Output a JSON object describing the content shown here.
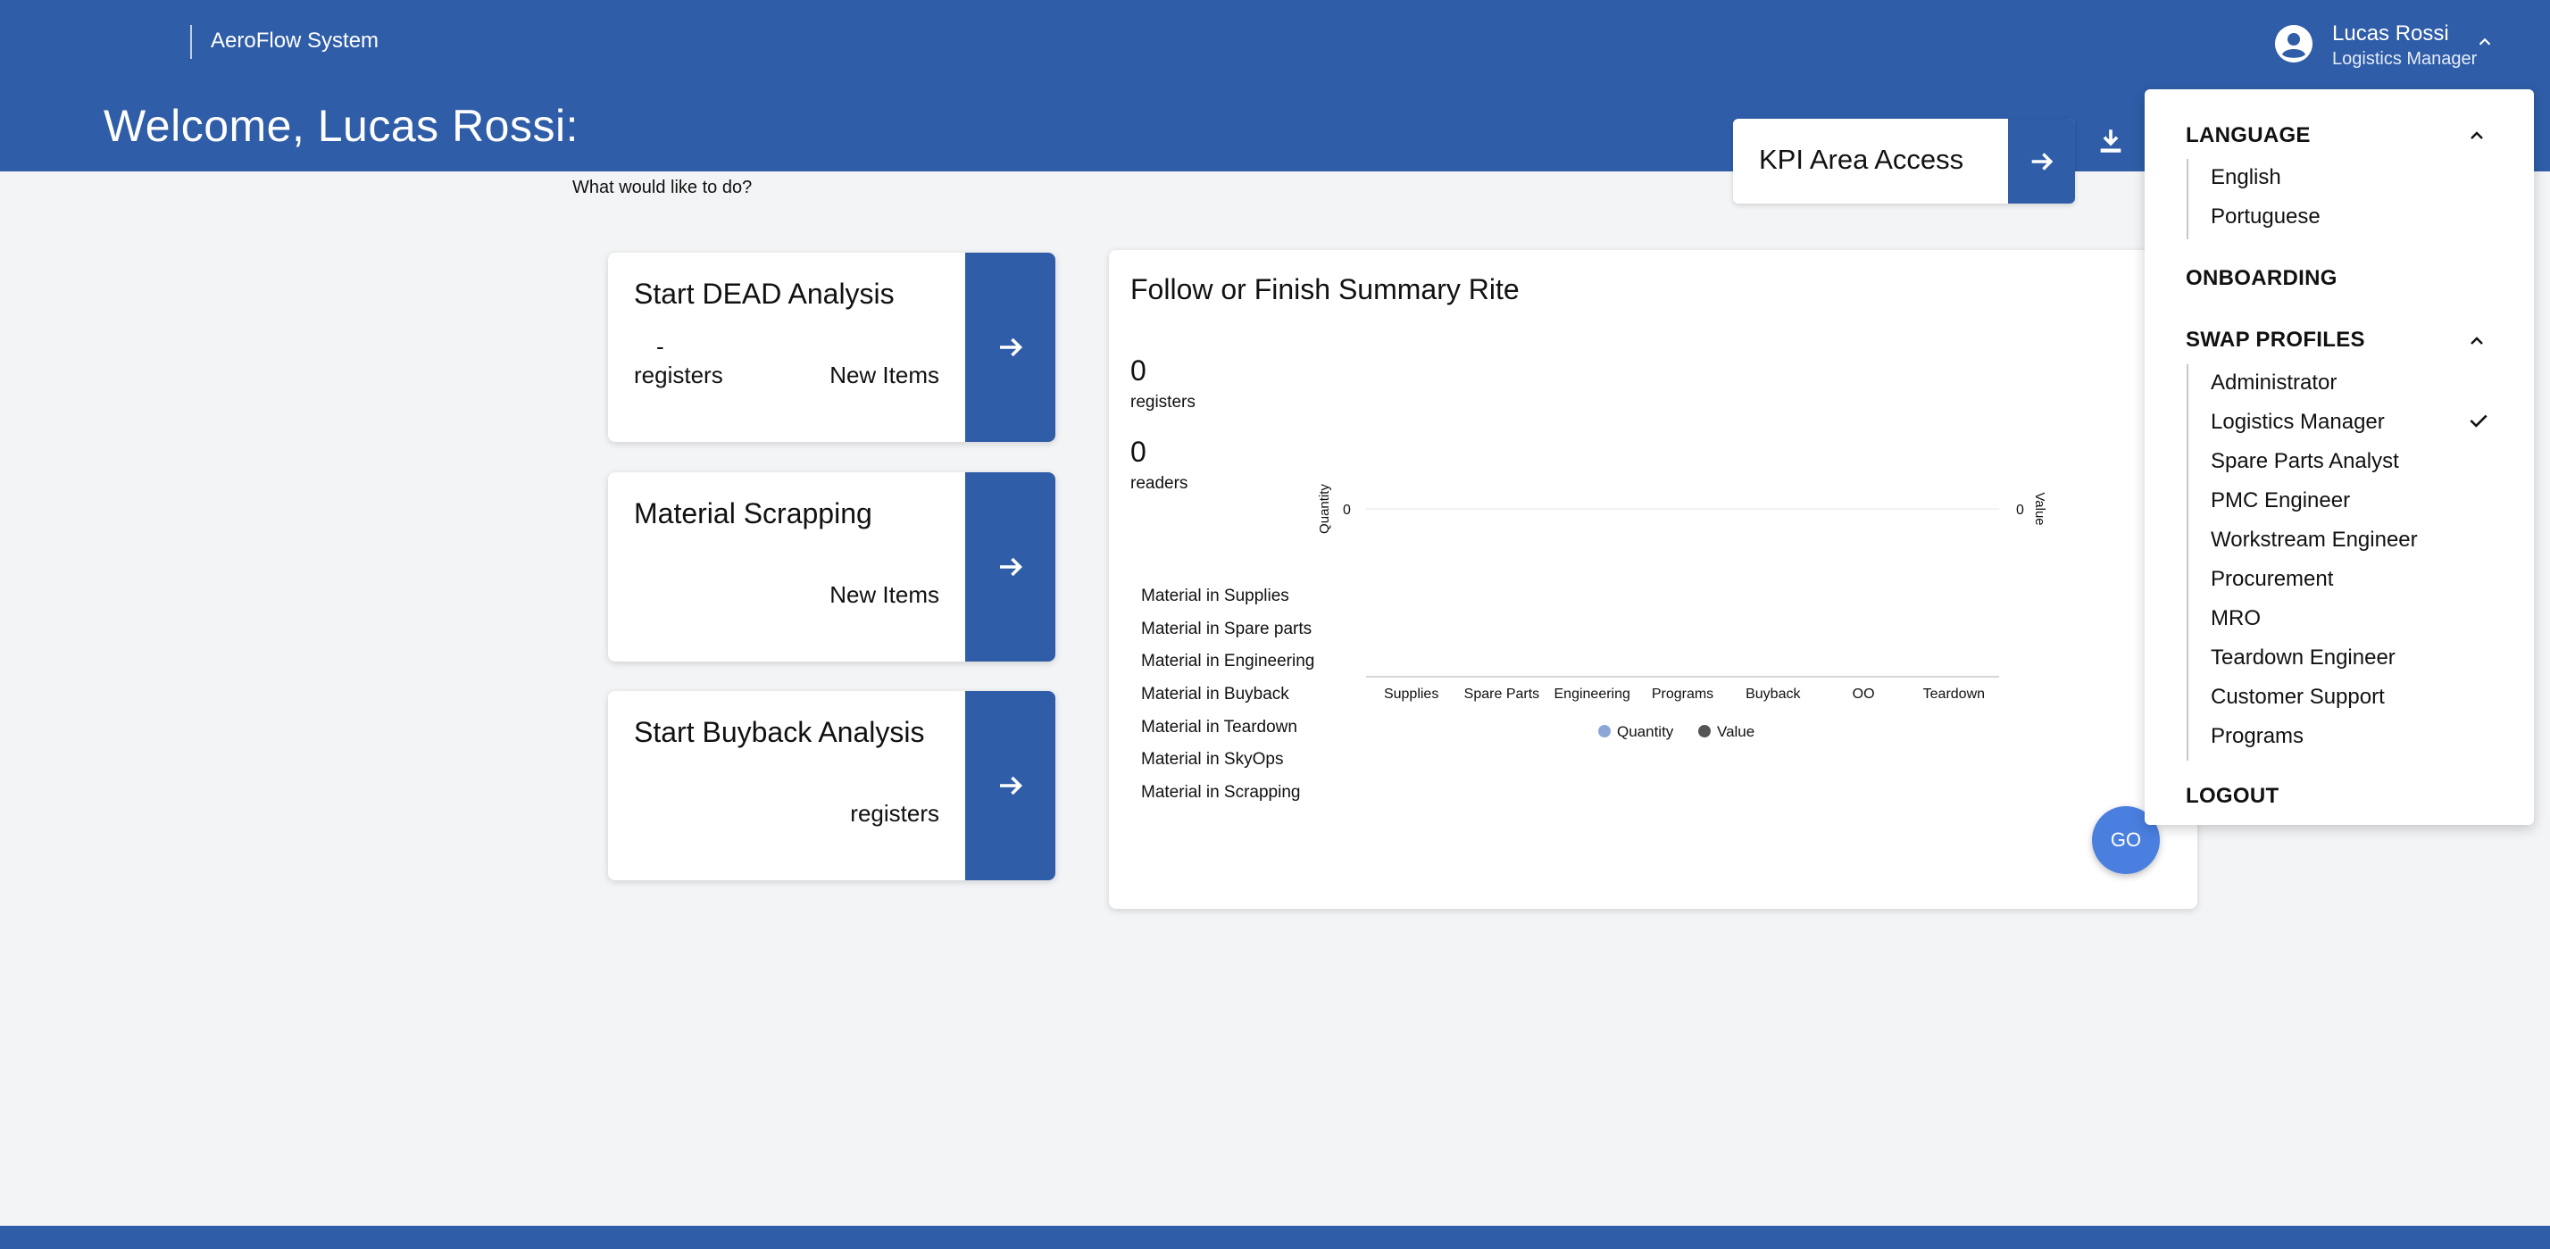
{
  "app": {
    "title": "AeroFlow System"
  },
  "header": {
    "welcome": "Welcome, Lucas Rossi:",
    "subtitle": "What would like to do?"
  },
  "user": {
    "name": "Lucas Rossi",
    "role": "Logistics Manager"
  },
  "kpi": {
    "label": "KPI Area Access"
  },
  "cards": [
    {
      "title": "Start DEAD Analysis",
      "dash": "-",
      "left": "registers",
      "right": "New Items"
    },
    {
      "title": "Material Scrapping",
      "left": "",
      "right": "New Items"
    },
    {
      "title": "Start Buyback Analysis",
      "left": "",
      "right": "registers"
    }
  ],
  "summary": {
    "title": "Follow or Finish Summary Rite",
    "registers_count": "0",
    "registers_label": "registers",
    "readers_count": "0",
    "readers_label": "readers",
    "materials": [
      "Material in Supplies",
      "Material in Spare parts",
      "Material in Engineering",
      "Material in Buyback",
      "Material in Teardown",
      "Material in SkyOps",
      "Material in Scrapping"
    ],
    "go_label": "GO"
  },
  "chart_data": {
    "type": "bar",
    "categories": [
      "Supplies",
      "Spare Parts",
      "Engineering",
      "Programs",
      "Buyback",
      "OO",
      "Teardown"
    ],
    "series": [
      {
        "name": "Quantity",
        "values": [
          0,
          0,
          0,
          0,
          0,
          0,
          0
        ],
        "color": "#8aa7d6"
      },
      {
        "name": "Value",
        "values": [
          0,
          0,
          0,
          0,
          0,
          0,
          0
        ],
        "color": "#555555"
      }
    ],
    "ylabel_left": "Quantity",
    "ylabel_right": "Value",
    "left_tick": "0",
    "right_tick": "0",
    "legend_position": "bottom"
  },
  "dropdown": {
    "language": {
      "header": "LANGUAGE",
      "items": [
        "English",
        "Portuguese"
      ]
    },
    "onboarding": "ONBOARDING",
    "profiles": {
      "header": "SWAP PROFILES",
      "items": [
        "Administrator",
        "Logistics Manager",
        "Spare Parts Analyst",
        "PMC Engineer",
        "Workstream Engineer",
        "Procurement",
        "MRO",
        "Teardown Engineer",
        "Customer Support",
        "Programs"
      ],
      "selected": "Logistics Manager"
    },
    "logout": "LOGOUT"
  },
  "colors": {
    "primary": "#2f5da8",
    "go_button": "#4a7fe0",
    "background": "#f3f4f6"
  },
  "icons": {
    "avatar": "account-circle-icon",
    "expand": "chevron-up-icon",
    "arrow": "arrow-right-icon",
    "download": "download-icon",
    "check": "check-icon"
  }
}
